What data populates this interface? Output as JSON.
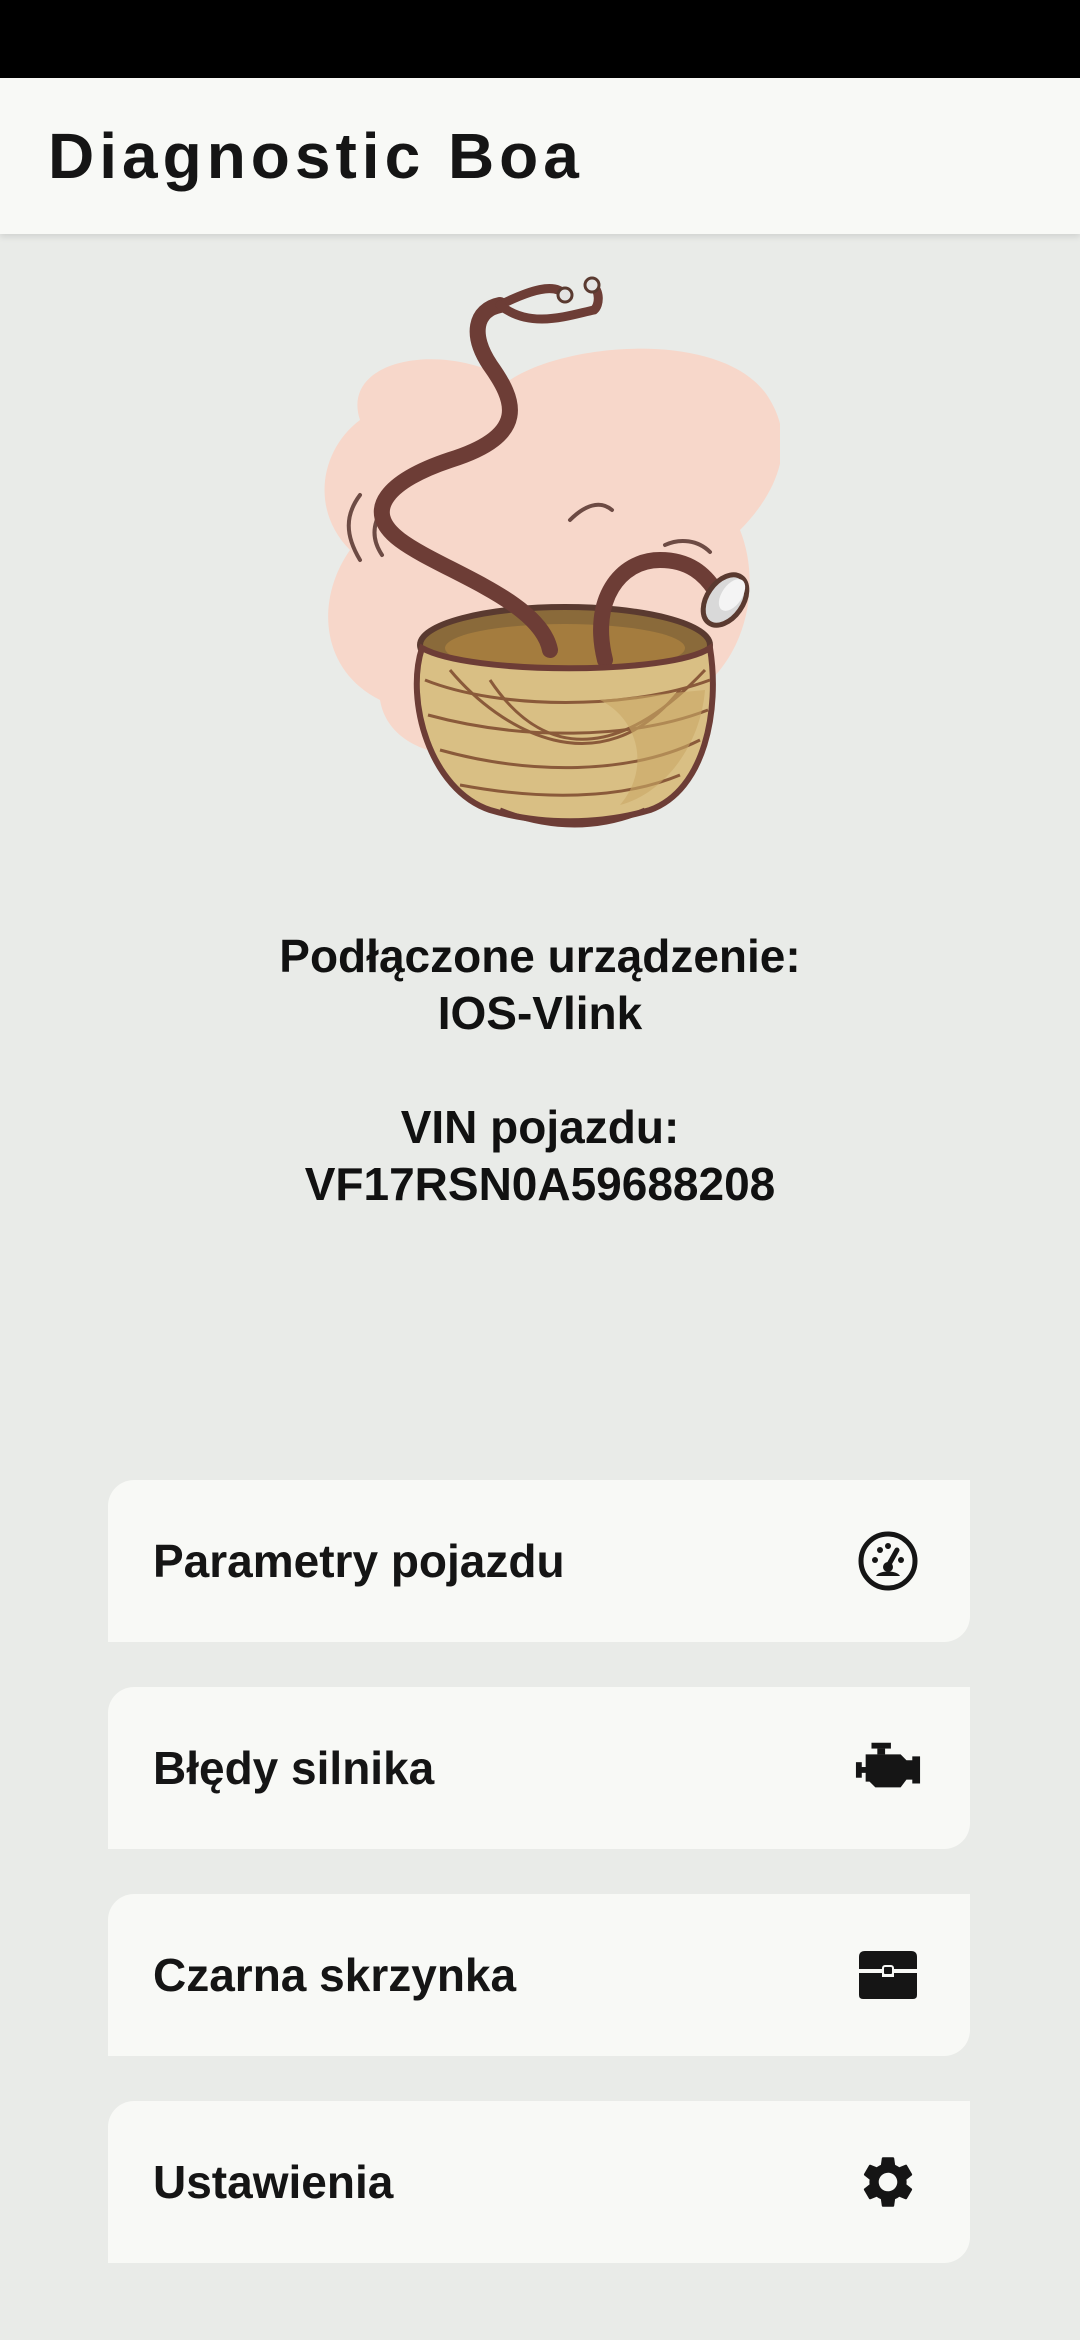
{
  "app": {
    "title": "Diagnostic Boa"
  },
  "status": {
    "device_label": "Podłączone urządzenie:",
    "device_value": "IOS-Vlink",
    "vin_label": "VIN pojazdu:",
    "vin_value": "VF17RSN0A59688208"
  },
  "hero": {
    "icon": "basket-with-stethoscope-snake-illustration"
  },
  "menu": {
    "items": [
      {
        "label": "Parametry pojazdu",
        "icon": "speedometer-icon"
      },
      {
        "label": "Błędy silnika",
        "icon": "engine-icon"
      },
      {
        "label": "Czarna skrzynka",
        "icon": "black-box-chest-icon"
      },
      {
        "label": "Ustawienia",
        "icon": "gear-icon"
      }
    ]
  },
  "colors": {
    "background": "#e9ebe8",
    "card": "#f8f9f6",
    "text": "#151515",
    "status_bar": "#000000",
    "blob": "#f7d7ca",
    "basket": "#d9bf84",
    "stethoscope": "#6d3d36"
  }
}
